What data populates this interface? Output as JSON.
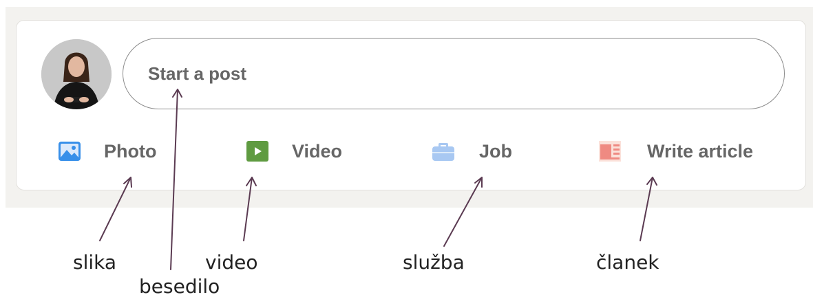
{
  "composer": {
    "placeholder": "Start a post",
    "actions": [
      {
        "label": "Photo",
        "icon": "photo-icon",
        "color": "#378fe9"
      },
      {
        "label": "Video",
        "icon": "video-icon",
        "color": "#5f9b41"
      },
      {
        "label": "Job",
        "icon": "briefcase-icon",
        "color": "#a8c8f2"
      },
      {
        "label": "Write article",
        "icon": "article-icon",
        "color": "#e06847"
      }
    ]
  },
  "annotations": {
    "photo": "slika",
    "text": "besedilo",
    "video": "video",
    "job": "služba",
    "article": "članek"
  },
  "colors": {
    "arrow": "#5b3b52",
    "background": "#f3f2ef"
  }
}
